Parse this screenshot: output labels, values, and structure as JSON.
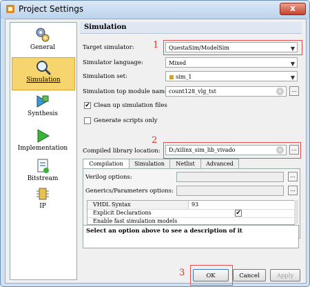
{
  "window": {
    "title": "Project Settings",
    "close_label": "x"
  },
  "nav": {
    "items": [
      {
        "label": "General"
      },
      {
        "label": "Simulation"
      },
      {
        "label": "Synthesis"
      },
      {
        "label": "Implementation"
      },
      {
        "label": "Bitstream"
      },
      {
        "label": "IP"
      }
    ]
  },
  "section_title": "Simulation",
  "form": {
    "target_simulator": {
      "label": "Target simulator:",
      "value": "QuestaSim/ModelSim"
    },
    "simulator_language": {
      "label": "Simulator language:",
      "value": "Mixed"
    },
    "simulation_set": {
      "label": "Simulation set:",
      "value": "sim_1"
    },
    "top_module": {
      "label": "Simulation top module name:",
      "value": "count128_vlg_tst"
    },
    "clean_up": {
      "label": "Clean up simulation files",
      "checked": true
    },
    "gen_scripts": {
      "label": "Generate scripts only",
      "checked": false
    },
    "compiled_lib": {
      "label": "Compiled library location:",
      "value": "D:/xilinx_sim_lib_vivado"
    }
  },
  "tabs": [
    "Compilation",
    "Simulation",
    "Netlist",
    "Advanced"
  ],
  "compilation": {
    "verilog_label": "Verilog options:",
    "generics_label": "Generics/Parameters options:",
    "grid_rows": [
      {
        "name": "VHDL Syntax",
        "value": "93"
      },
      {
        "name": "Explicit Declarations",
        "value": "checked"
      },
      {
        "name": "Enable fast simulation models",
        "value": ""
      }
    ]
  },
  "description": "Select an option above to see a description of it",
  "annotations": {
    "a1": "1",
    "a2": "2",
    "a3": "3"
  },
  "buttons": {
    "ok": "OK",
    "cancel": "Cancel",
    "apply": "Apply",
    "browse": "..."
  },
  "colors": {
    "accent": "#3a78c8",
    "selection": "#f7d56e",
    "annotation": "#e03030"
  }
}
